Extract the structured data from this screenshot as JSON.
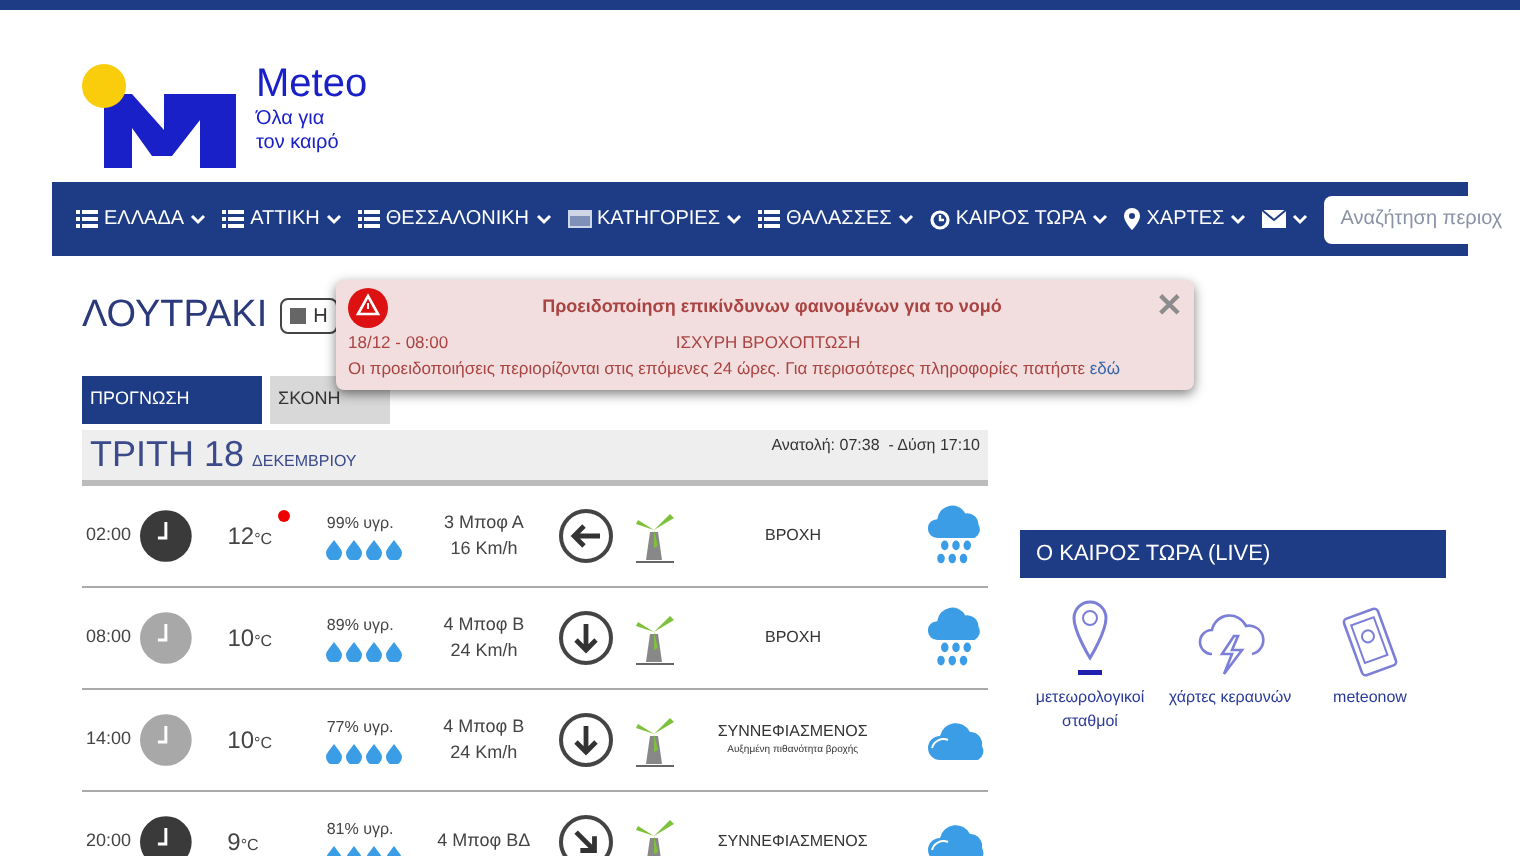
{
  "logo": {
    "name": "Meteo",
    "tagline": [
      "Όλα για",
      "τον καιρό"
    ]
  },
  "nav": {
    "items": [
      {
        "label": "ΕΛΛΑΔΑ",
        "kind": "list"
      },
      {
        "label": "ΑΤΤΙΚΗ",
        "kind": "list"
      },
      {
        "label": "ΘΕΣΣΑΛΟΝΙΚΗ",
        "kind": "list"
      },
      {
        "label": "ΚΑΤΗΓΟΡΙΕΣ",
        "kind": "grid"
      },
      {
        "label": "ΘΑΛΑΣΣΕΣ",
        "kind": "list"
      },
      {
        "label": "ΚΑΙΡΟΣ ΤΩΡΑ",
        "kind": "clock"
      },
      {
        "label": "ΧΑΡΤΕΣ",
        "kind": "pin"
      },
      {
        "kind": "mail"
      }
    ],
    "search": {
      "placeholder": "Αναζήτηση περιοχ"
    }
  },
  "city": {
    "title": "ΛΟΥΤΡΑΚΙ",
    "button": "Η"
  },
  "tabs": [
    {
      "label": "ΠΡΟΓΝΩΣΗ",
      "selected": true
    },
    {
      "label": "ΣΚΟΝΗ",
      "selected": false
    }
  ],
  "alert": {
    "title": "Προειδοποίηση επικίνδυνων φαινομένων για το νομό",
    "time": "18/12 - 08:00",
    "phenomenon": "ΙΣΧΥΡΗ ΒΡΟΧΟΠΤΩΣΗ",
    "message": "Οι προειδοποιήσεις περιορίζονται στις επόμενες 24 ώρες. Για περισσότερες πληροφορίες πατήστε",
    "link": "εδώ",
    "close": "✕"
  },
  "day": {
    "title": "ΤΡΙΤΗ 18",
    "month": "ΔΕΚΕΜΒΡΙΟΥ",
    "sun": "Ανατολή: 07:38  - Δύση 17:10"
  },
  "forecast": [
    {
      "time": "02:00",
      "night": true,
      "temp": "12",
      "unit": "°C",
      "warning": true,
      "humidity": "99% υγρ.",
      "wind": "3 Μποφ Α",
      "speed": "16 Km/h",
      "arrow": {
        "kind": "left"
      },
      "condition": "ΒΡΟΧΗ",
      "kind": "rain"
    },
    {
      "time": "08:00",
      "night": false,
      "temp": "10",
      "unit": "°C",
      "warning": false,
      "humidity": "89% υγρ.",
      "wind": "4 Μποφ Β",
      "speed": "24 Km/h",
      "arrow": {
        "kind": "down"
      },
      "condition": "ΒΡΟΧΗ",
      "kind": "rain"
    },
    {
      "time": "14:00",
      "night": false,
      "temp": "10",
      "unit": "°C",
      "warning": false,
      "humidity": "77% υγρ.",
      "wind": "4 Μποφ Β",
      "speed": "24 Km/h",
      "arrow": {
        "kind": "down"
      },
      "condition": "ΣΥΝΝΕΦΙΑΣΜΕΝΟΣ",
      "note": "Αυξημένη πιθανότητα βροχής",
      "kind": "cloudy"
    },
    {
      "time": "20:00",
      "night": true,
      "temp": "9",
      "unit": "°C",
      "warning": false,
      "humidity": "81% υγρ.",
      "wind": "4 Μποφ ΒΔ",
      "arrow": {
        "kind": "down-right"
      },
      "condition": "ΣΥΝΝΕΦΙΑΣΜΕΝΟΣ",
      "kind": "cloudy"
    }
  ],
  "live": {
    "title": "Ο ΚΑΙΡΟΣ ΤΩΡΑ (LIVE)",
    "items": [
      {
        "label": "μετεωρολογικοί σταθμοί",
        "kind": "pin"
      },
      {
        "label": "χάρτες κεραυνών",
        "kind": "lightning"
      },
      {
        "label": "meteonow",
        "kind": "phone"
      }
    ]
  }
}
